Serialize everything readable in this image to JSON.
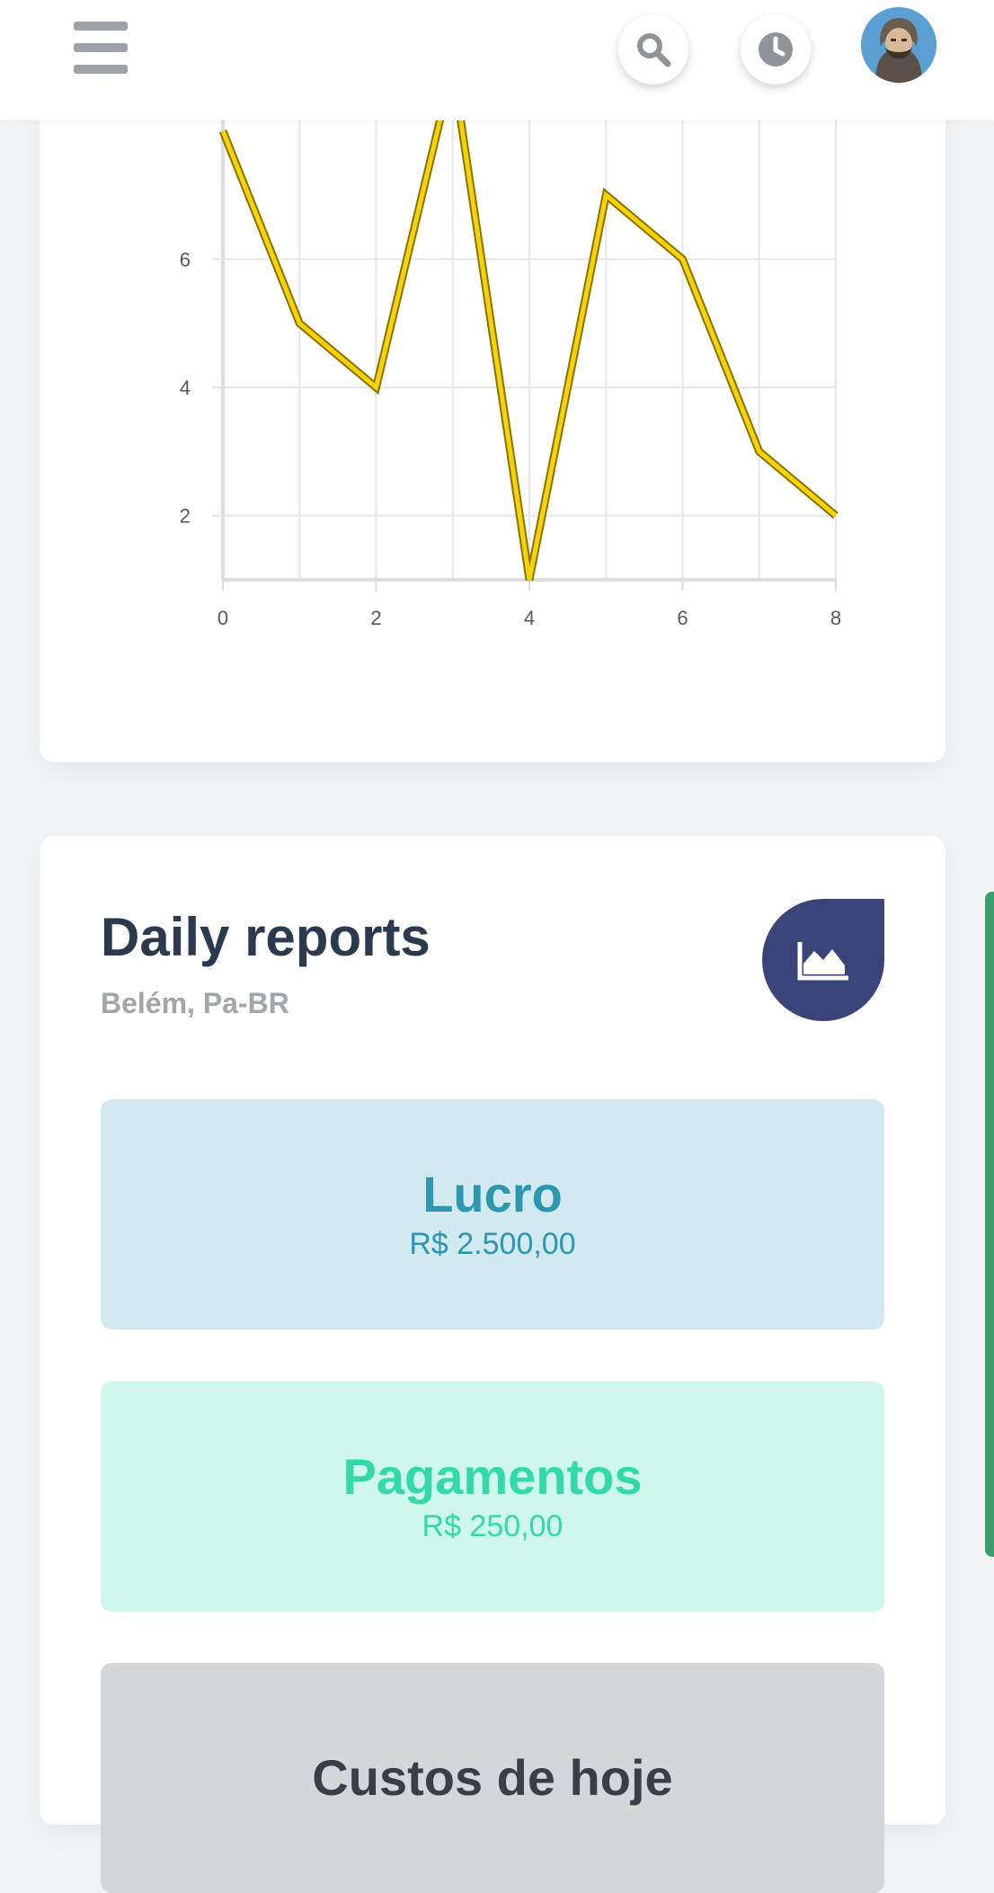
{
  "header": {
    "icons": {
      "menu": "hamburger-menu-icon",
      "search": "search-icon",
      "history": "clock-icon",
      "avatar": "user-avatar"
    }
  },
  "chart_data": {
    "type": "line",
    "x": [
      0,
      1,
      2,
      3,
      4,
      5,
      6,
      7,
      8
    ],
    "y": [
      8,
      5,
      4,
      9,
      1,
      7,
      6,
      3,
      2
    ],
    "xlim": [
      0,
      8
    ],
    "ylim": [
      1,
      7
    ],
    "xticks": [
      0,
      2,
      4,
      6,
      8
    ],
    "yticks": [
      2,
      4,
      6
    ],
    "grid": true,
    "line_color": "#f5d20a",
    "line_outline_color": "#8a7400"
  },
  "reports": {
    "title": "Daily reports",
    "subtitle": "Belém, Pa-BR",
    "icon": "area-chart-icon",
    "icon_color": "#3b4479",
    "items": [
      {
        "label": "Lucro",
        "value": "R$ 2.500,00",
        "color": "#2e97b0"
      },
      {
        "label": "Pagamentos",
        "value": "R$ 250,00",
        "color": "#33d9a8"
      },
      {
        "label": "Custos de hoje"
      }
    ]
  }
}
